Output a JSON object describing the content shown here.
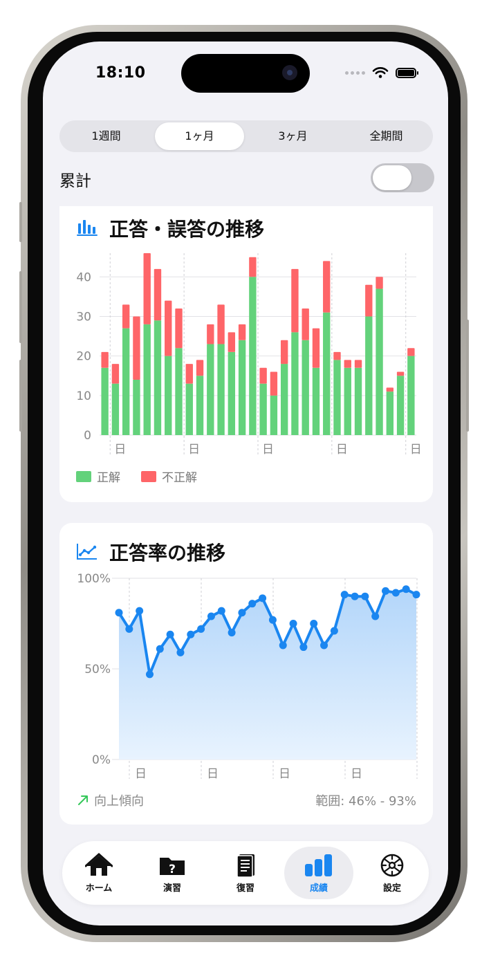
{
  "status_bar": {
    "time": "18:10"
  },
  "period_tabs": [
    "1週間",
    "1ヶ月",
    "3ヶ月",
    "全期間"
  ],
  "active_period": 1,
  "cumulative": {
    "label": "累計",
    "enabled": false
  },
  "bar_card": {
    "title": "正答・誤答の推移",
    "legend": {
      "correct": "正解",
      "incorrect": "不正解"
    },
    "colors": {
      "correct": "#63d27b",
      "incorrect": "#fe6568"
    }
  },
  "line_card": {
    "title": "正答率の推移",
    "trend_label": "向上傾向",
    "range_label": "範囲: 46% - 93%",
    "colors": {
      "line": "#1a86f0",
      "fill": "#bcdcfb"
    }
  },
  "chart_data": [
    {
      "type": "bar",
      "stacked": true,
      "series": [
        {
          "name": "正解",
          "values": [
            17,
            13,
            27,
            14,
            28,
            29,
            20,
            22,
            13,
            15,
            23,
            23,
            21,
            24,
            40,
            13,
            10,
            18,
            26,
            24,
            17,
            31,
            19,
            17,
            17,
            30,
            37,
            11,
            15,
            20
          ]
        },
        {
          "name": "不正解",
          "values": [
            4,
            5,
            6,
            16,
            18,
            13,
            14,
            10,
            5,
            4,
            5,
            10,
            5,
            4,
            5,
            4,
            6,
            6,
            16,
            8,
            10,
            13,
            2,
            2,
            2,
            8,
            3,
            1,
            1,
            2
          ]
        }
      ],
      "x_tick_labels": [
        "日",
        "日",
        "日",
        "日",
        "日"
      ],
      "y_ticks": [
        0,
        10,
        20,
        30,
        40
      ],
      "ylim": [
        0,
        46
      ],
      "grid": true,
      "legend_position": "bottom-left"
    },
    {
      "type": "area",
      "values": [
        81,
        72,
        82,
        47,
        61,
        69,
        59,
        69,
        72,
        79,
        82,
        70,
        81,
        86,
        89,
        77,
        63,
        75,
        62,
        75,
        63,
        71,
        91,
        90,
        90,
        79,
        93,
        92,
        94,
        91
      ],
      "y_ticks": [
        "0%",
        "50%",
        "100%"
      ],
      "ylim": [
        0,
        100
      ],
      "x_tick_labels": [
        "日",
        "日",
        "日",
        "日"
      ],
      "grid": true
    }
  ],
  "tab_bar": {
    "items": [
      {
        "label": "ホーム",
        "icon": "house-icon"
      },
      {
        "label": "演習",
        "icon": "question-folder-icon"
      },
      {
        "label": "復習",
        "icon": "notebook-icon"
      },
      {
        "label": "成績",
        "icon": "bar-chart-icon"
      },
      {
        "label": "設定",
        "icon": "gear-icon"
      }
    ],
    "active": 3
  }
}
